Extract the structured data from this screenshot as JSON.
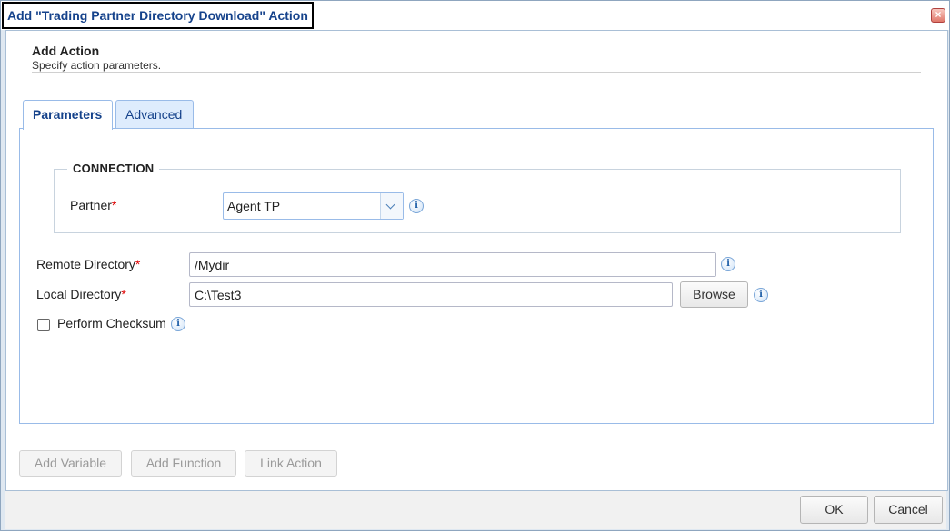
{
  "window": {
    "title": "Add \"Trading Partner Directory Download\" Action",
    "close_icon": "close-icon"
  },
  "header": {
    "title": "Add Action",
    "subtitle": "Specify action parameters."
  },
  "tabs": [
    {
      "label": "Parameters",
      "active": true
    },
    {
      "label": "Advanced",
      "active": false
    }
  ],
  "connection": {
    "legend": "CONNECTION",
    "partner_label": "Partner",
    "partner_value": "Agent TP"
  },
  "fields": {
    "remote_directory_label": "Remote Directory",
    "remote_directory_value": "/Mydir",
    "local_directory_label": "Local Directory",
    "local_directory_value": "C:\\Test3",
    "browse_label": "Browse",
    "checksum_label": "Perform Checksum",
    "checksum_checked": false,
    "required_marker": "*",
    "info_glyph": "i"
  },
  "actions": {
    "add_variable": "Add Variable",
    "add_function": "Add Function",
    "link_action": "Link Action"
  },
  "footer": {
    "ok": "OK",
    "cancel": "Cancel"
  },
  "colors": {
    "title_text": "#15428b",
    "required": "#dd0000",
    "tab_border": "#99bbe8"
  }
}
